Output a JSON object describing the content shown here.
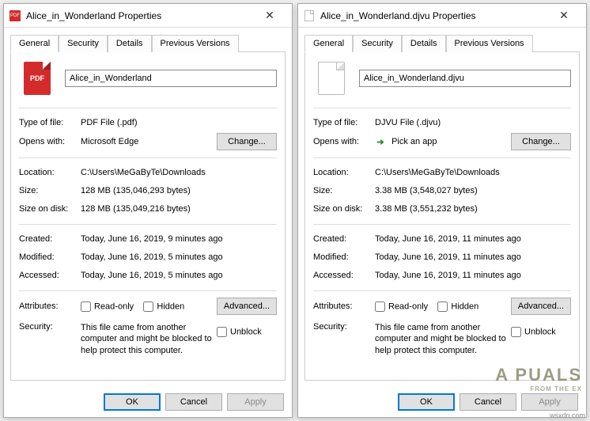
{
  "dialogs": [
    {
      "title": "Alice_in_Wonderland Properties",
      "tabs": [
        "General",
        "Security",
        "Details",
        "Previous Versions"
      ],
      "icon_kind": "pdf",
      "icon_label": "PDF",
      "filename": "Alice_in_Wonderland",
      "type_label": "Type of file:",
      "type_value": "PDF File (.pdf)",
      "opens_label": "Opens with:",
      "opens_value": "Microsoft Edge",
      "opens_icon": "none",
      "change_btn": "Change...",
      "location_label": "Location:",
      "location_value": "C:\\Users\\MeGaByTe\\Downloads",
      "size_label": "Size:",
      "size_value": "128 MB (135,046,293 bytes)",
      "sod_label": "Size on disk:",
      "sod_value": "128 MB (135,049,216 bytes)",
      "created_label": "Created:",
      "created_value": "Today, June 16, 2019, 9 minutes ago",
      "modified_label": "Modified:",
      "modified_value": "Today, June 16, 2019, 5 minutes ago",
      "accessed_label": "Accessed:",
      "accessed_value": "Today, June 16, 2019, 5 minutes ago",
      "attributes_label": "Attributes:",
      "readonly_label": "Read-only",
      "hidden_label": "Hidden",
      "advanced_btn": "Advanced...",
      "security_label": "Security:",
      "security_text": "This file came from another computer and might be blocked to help protect this computer.",
      "unblock_label": "Unblock",
      "ok": "OK",
      "cancel": "Cancel",
      "apply": "Apply"
    },
    {
      "title": "Alice_in_Wonderland.djvu Properties",
      "tabs": [
        "General",
        "Security",
        "Details",
        "Previous Versions"
      ],
      "icon_kind": "generic",
      "icon_label": "",
      "filename": "Alice_in_Wonderland.djvu",
      "type_label": "Type of file:",
      "type_value": "DJVU File (.djvu)",
      "opens_label": "Opens with:",
      "opens_value": "Pick an app",
      "opens_icon": "arrow",
      "change_btn": "Change...",
      "location_label": "Location:",
      "location_value": "C:\\Users\\MeGaByTe\\Downloads",
      "size_label": "Size:",
      "size_value": "3.38 MB (3,548,027 bytes)",
      "sod_label": "Size on disk:",
      "sod_value": "3.38 MB (3,551,232 bytes)",
      "created_label": "Created:",
      "created_value": "Today, June 16, 2019, 11 minutes ago",
      "modified_label": "Modified:",
      "modified_value": "Today, June 16, 2019, 11 minutes ago",
      "accessed_label": "Accessed:",
      "accessed_value": "Today, June 16, 2019, 11 minutes ago",
      "attributes_label": "Attributes:",
      "readonly_label": "Read-only",
      "hidden_label": "Hidden",
      "advanced_btn": "Advanced...",
      "security_label": "Security:",
      "security_text": "This file came from another computer and might be blocked to help protect this computer.",
      "unblock_label": "Unblock",
      "ok": "OK",
      "cancel": "Cancel",
      "apply": "Apply"
    }
  ],
  "watermark": {
    "main": "A  PUALS",
    "sub": "FROM THE EX"
  },
  "source": "wsxdn.com"
}
